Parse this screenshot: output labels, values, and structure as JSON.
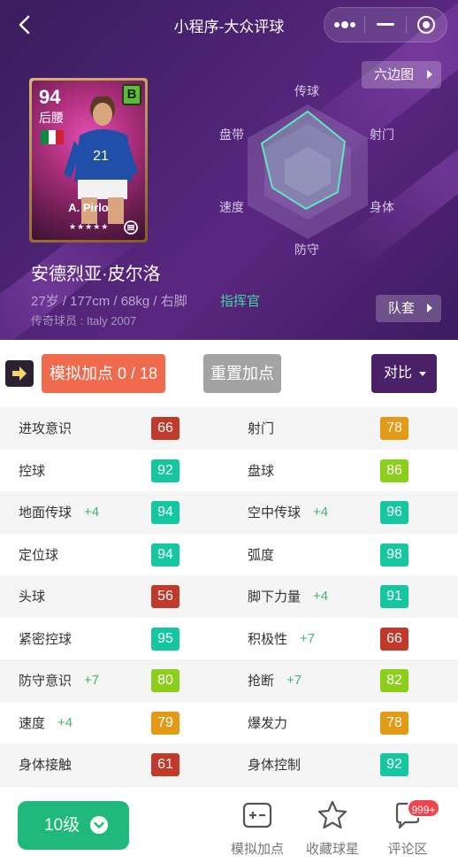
{
  "header": {
    "title": "小程序-大众评球"
  },
  "card": {
    "overall": "94",
    "position": "后腰",
    "rank": "B",
    "name": "A. Pirlo",
    "stars": "★★★★★"
  },
  "radar": {
    "button_label": "六边图",
    "axes": [
      "传球",
      "射门",
      "身体",
      "防守",
      "速度",
      "盘带"
    ]
  },
  "player": {
    "full_name": "安德烈亚·皮尔洛",
    "info": "27岁 / 177cm / 68kg / 右脚",
    "role": "指挥官",
    "legend": "传奇球员 : Italy 2007",
    "kit_label": "队套"
  },
  "actions": {
    "simulate_label": "模拟加点 0 / 18",
    "reset_label": "重置加点",
    "compare_label": "对比"
  },
  "colors": {
    "red": "#c0392b",
    "orange": "#e39a16",
    "lime": "#8ccf1a",
    "teal": "#15c7a0",
    "accent_purple": "#4a2166"
  },
  "stats": [
    {
      "left": {
        "name": "进攻意识",
        "bonus": "",
        "value": "66",
        "color": "red"
      },
      "right": {
        "name": "射门",
        "bonus": "",
        "value": "78",
        "color": "orange"
      }
    },
    {
      "left": {
        "name": "控球",
        "bonus": "",
        "value": "92",
        "color": "teal"
      },
      "right": {
        "name": "盘球",
        "bonus": "",
        "value": "86",
        "color": "lime"
      }
    },
    {
      "left": {
        "name": "地面传球",
        "bonus": "+4",
        "value": "94",
        "color": "teal"
      },
      "right": {
        "name": "空中传球",
        "bonus": "+4",
        "value": "96",
        "color": "teal"
      }
    },
    {
      "left": {
        "name": "定位球",
        "bonus": "",
        "value": "94",
        "color": "teal"
      },
      "right": {
        "name": "弧度",
        "bonus": "",
        "value": "98",
        "color": "teal"
      }
    },
    {
      "left": {
        "name": "头球",
        "bonus": "",
        "value": "56",
        "color": "red"
      },
      "right": {
        "name": "脚下力量",
        "bonus": "+4",
        "value": "91",
        "color": "teal"
      }
    },
    {
      "left": {
        "name": "紧密控球",
        "bonus": "",
        "value": "95",
        "color": "teal"
      },
      "right": {
        "name": "积极性",
        "bonus": "+7",
        "value": "66",
        "color": "red"
      }
    },
    {
      "left": {
        "name": "防守意识",
        "bonus": "+7",
        "value": "80",
        "color": "lime"
      },
      "right": {
        "name": "抢断",
        "bonus": "+7",
        "value": "82",
        "color": "lime"
      }
    },
    {
      "left": {
        "name": "速度",
        "bonus": "+4",
        "value": "79",
        "color": "orange"
      },
      "right": {
        "name": "爆发力",
        "bonus": "",
        "value": "78",
        "color": "orange"
      }
    },
    {
      "left": {
        "name": "身体接触",
        "bonus": "",
        "value": "61",
        "color": "red"
      },
      "right": {
        "name": "身体控制",
        "bonus": "",
        "value": "92",
        "color": "teal"
      }
    }
  ],
  "bottom": {
    "level_label": "10级",
    "tabs": [
      {
        "label": "模拟加点",
        "icon": "plus-minus-icon"
      },
      {
        "label": "收藏球星",
        "icon": "star-icon"
      },
      {
        "label": "评论区",
        "icon": "comment-icon"
      }
    ],
    "badge": "999+"
  }
}
